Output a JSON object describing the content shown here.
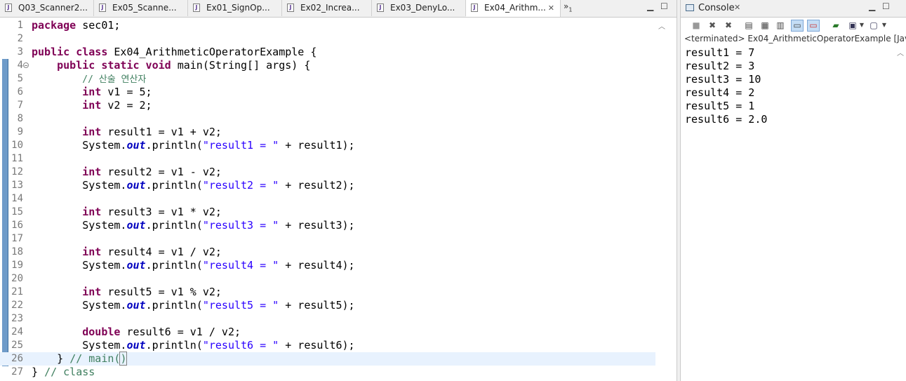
{
  "editor": {
    "tabs": [
      {
        "label": "Q03_Scanner2..."
      },
      {
        "label": "Ex05_Scanne..."
      },
      {
        "label": "Ex01_SignOp..."
      },
      {
        "label": "Ex02_Increa..."
      },
      {
        "label": "Ex03_DenyLo..."
      },
      {
        "label": "Ex04_Arithm...",
        "active": true
      }
    ],
    "overflow_label": "»",
    "overflow_count": "1",
    "active_file": "Ex04_ArithmeticOperatorExample",
    "current_line": 26
  },
  "console": {
    "title": "Console",
    "status": "<terminated> Ex04_ArithmeticOperatorExample [Java App",
    "output": [
      "result1 = 7",
      "result2 = 3",
      "result3 = 10",
      "result4 = 2",
      "result5 = 1",
      "result6 = 2.0"
    ]
  },
  "colors": {
    "keyword": "#7f0055",
    "comment": "#3f7f5f",
    "string": "#2a00ff",
    "field": "#0000c0",
    "current_line_bg": "#e8f2fe"
  }
}
